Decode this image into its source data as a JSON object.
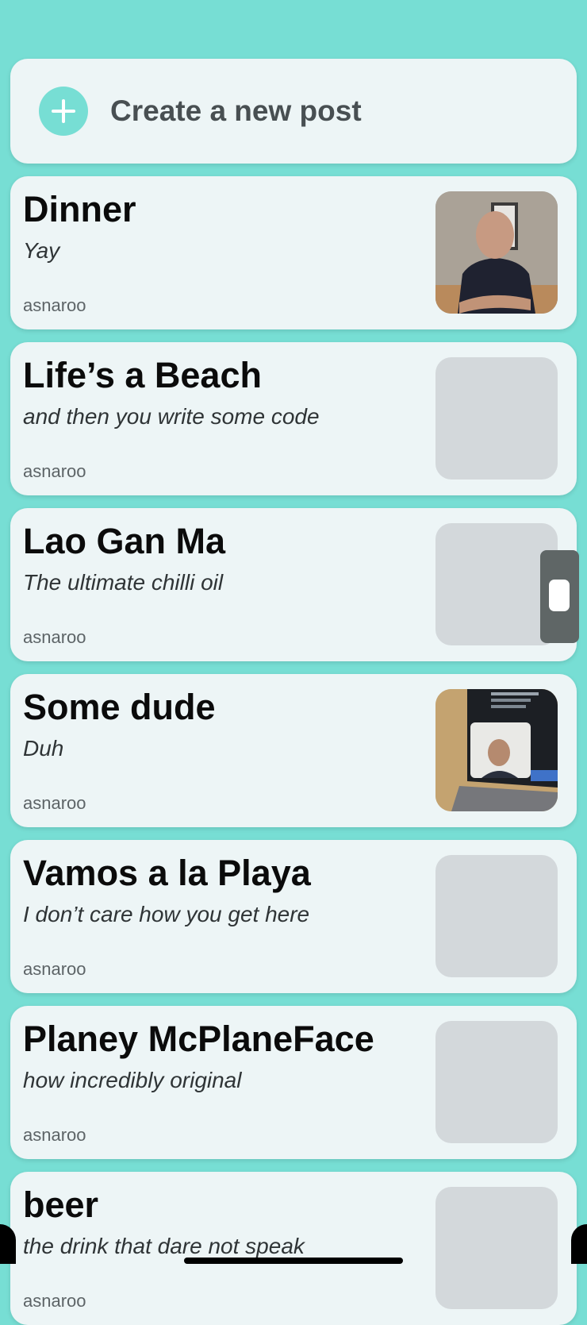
{
  "create": {
    "label": "Create a new post",
    "icon": "plus-icon"
  },
  "posts": [
    {
      "title": "Dinner",
      "subtitle": "Yay",
      "author": "asnaroo",
      "image": "photo-man-seated"
    },
    {
      "title": "Life’s a Beach",
      "subtitle": "and then you write some code",
      "author": "asnaroo",
      "image": "placeholder"
    },
    {
      "title": "Lao Gan Ma",
      "subtitle": "The ultimate chilli oil",
      "author": "asnaroo",
      "image": "placeholder"
    },
    {
      "title": "Some dude",
      "subtitle": "Duh",
      "author": "asnaroo",
      "image": "photo-laptop-video-call"
    },
    {
      "title": "Vamos a la Playa",
      "subtitle": "I don’t care how you get here",
      "author": "asnaroo",
      "image": "placeholder"
    },
    {
      "title": "Planey McPlaneFace",
      "subtitle": "how incredibly original",
      "author": "asnaroo",
      "image": "placeholder"
    },
    {
      "title": "beer",
      "subtitle": "the drink that dare not speak",
      "author": "asnaroo",
      "image": "placeholder"
    }
  ],
  "colors": {
    "background": "#77ded4",
    "card": "#edf5f6",
    "accent": "#77ded4",
    "placeholder": "#d3d8db"
  }
}
